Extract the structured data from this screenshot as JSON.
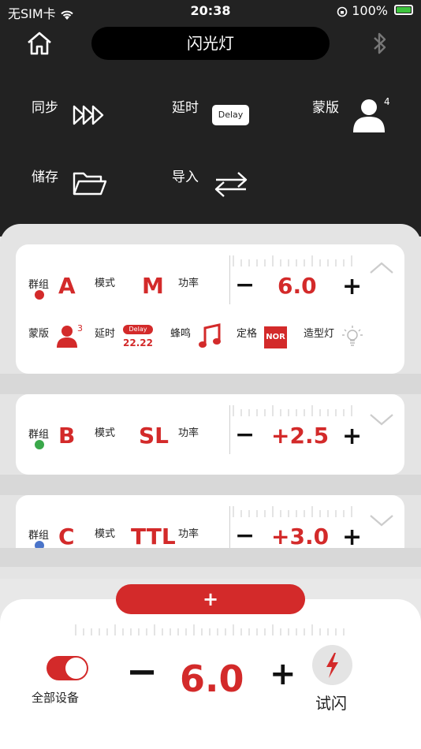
{
  "status": {
    "carrier": "无SIM卡",
    "time": "20:38",
    "battery": "100%"
  },
  "header": {
    "title": "闪光灯",
    "home_icon": "home-icon",
    "bt_icon": "bluetooth-icon"
  },
  "top_menu": {
    "sync": "同步",
    "delay": "延时",
    "delay_badge": "Delay",
    "mask": "蒙版",
    "mask_count": "4",
    "save": "储存",
    "import": "导入"
  },
  "groups": [
    {
      "group_label": "群组",
      "group": "A",
      "dot_color": "#d32a2a",
      "mode_label": "模式",
      "mode": "M",
      "power_label": "功率",
      "value": "6.0",
      "minus": "−",
      "plus": "+"
    },
    {
      "group_label": "群组",
      "group": "B",
      "dot_color": "#3aa84a",
      "mode_label": "模式",
      "mode": "SL",
      "power_label": "功率",
      "value": "+2.5",
      "minus": "−",
      "plus": "+"
    },
    {
      "group_label": "群组",
      "group": "C",
      "dot_color": "#4a74c9",
      "mode_label": "模式",
      "mode": "TTL",
      "power_label": "功率",
      "value": "+3.0",
      "minus": "−",
      "plus": "+"
    }
  ],
  "group_a_extras": {
    "mask_label": "蒙版",
    "mask_count": "3",
    "delay_label": "延时",
    "delay_badge": "Delay",
    "delay_value": "22.22",
    "beep_label": "蜂鸣",
    "freeze_label": "定格",
    "freeze_badge": "NOR",
    "model_light_label": "造型灯"
  },
  "bottom": {
    "add_label": "+",
    "all_devices": "全部设备",
    "value": "6.0",
    "minus": "−",
    "plus": "+",
    "test_flash": "试闪",
    "accent": "#d32a2a"
  }
}
